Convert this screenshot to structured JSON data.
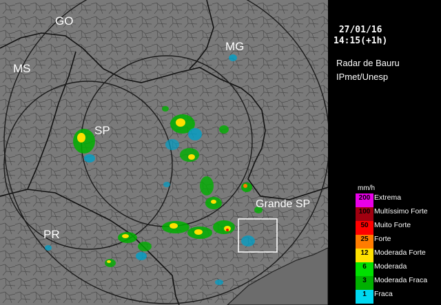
{
  "labels": {
    "go": "GO",
    "mg": "MG",
    "ms": "MS",
    "sp": "SP",
    "pr": "PR",
    "grande_sp": "Grande SP"
  },
  "info": {
    "date": "27/01/16",
    "time": "14:15(+1h)",
    "radar": "Radar de Bauru",
    "org": "IPmet/Unesp"
  },
  "legend": {
    "unit": "mm/h",
    "entries": [
      {
        "value": "200",
        "label": "Extrema",
        "color": "#e800e8"
      },
      {
        "value": "100",
        "label": "Multíssimo Forte",
        "color": "#a00010"
      },
      {
        "value": "50",
        "label": "Muito Forte",
        "color": "#ff0000"
      },
      {
        "value": "25",
        "label": "Forte",
        "color": "#ff7c00"
      },
      {
        "value": "12",
        "label": "Moderada Forte",
        "color": "#ffe000"
      },
      {
        "value": "6",
        "label": "Moderada",
        "color": "#00e000"
      },
      {
        "value": "3",
        "label": "Moderada Fraca",
        "color": "#00b000"
      },
      {
        "value": "1",
        "label": "Fraca",
        "color": "#00d8f0"
      }
    ]
  },
  "colors": {
    "map_background": "#7a7a7a",
    "panel_background": "#000000",
    "grande_sp_box": "#ffffff"
  }
}
